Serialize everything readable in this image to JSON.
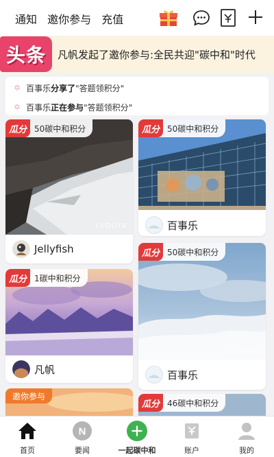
{
  "topbar": {
    "tabs": [
      "通知",
      "邀你参与",
      "充值"
    ]
  },
  "banner": {
    "badge": "头条",
    "text": "凡帆发起了邀你参与:全民共迎\"碳中和\"时代"
  },
  "activity": [
    {
      "user": "百事乐",
      "action": "分享了",
      "target": "\"答题领积分\""
    },
    {
      "user": "百事乐",
      "action": "正在参与",
      "target": "\"答题领积分\""
    }
  ],
  "points_tag": "瓜分",
  "cards": [
    {
      "points": "50碳中和积分",
      "user": "Jellyfish",
      "watermark": "LVDOYA"
    },
    {
      "points": "50碳中和积分",
      "user": "百事乐",
      "watermark": ""
    },
    {
      "points": "1碳中和积分",
      "user": "凡帆",
      "watermark": ""
    },
    {
      "points": "50碳中和积分",
      "user": "百事乐",
      "watermark": "LVDOYA"
    },
    {
      "invite": "邀你参与"
    },
    {
      "points": "46碳中和积分"
    }
  ],
  "bottom_nav": [
    {
      "label": "首页",
      "icon": "home-icon"
    },
    {
      "label": "要闻",
      "icon": "news-icon"
    },
    {
      "label": "一起碳中和",
      "icon": "plus-circle-icon"
    },
    {
      "label": "账户",
      "icon": "account-icon"
    },
    {
      "label": "我的",
      "icon": "profile-icon"
    }
  ],
  "colors": {
    "headline_badge": "#e8436b",
    "points_tag": "#e23a3a",
    "center_button": "#3fb24f",
    "invite_tag": "#f07a2a"
  }
}
